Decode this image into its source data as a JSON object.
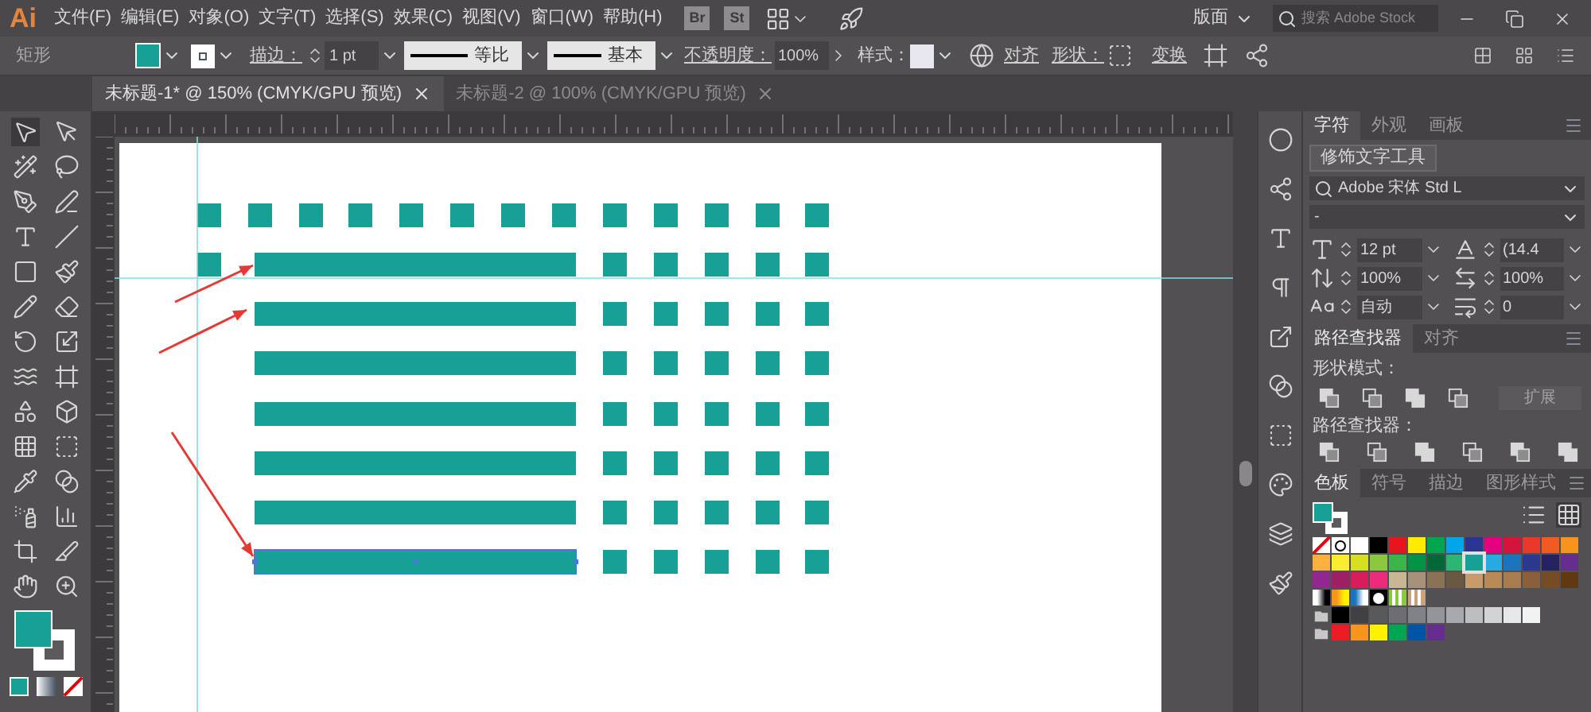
{
  "app": {
    "logo": "Ai",
    "menu": [
      "文件(F)",
      "编辑(E)",
      "对象(O)",
      "文字(T)",
      "选择(S)",
      "效果(C)",
      "视图(V)",
      "窗口(W)",
      "帮助(H)"
    ],
    "bridge": "Br",
    "stock": "St",
    "workspace": "版面",
    "search_placeholder": "搜索 Adobe Stock"
  },
  "fill": {
    "color": "#16a096"
  },
  "control_bar": {
    "object_type": "矩形",
    "stroke_label": "描边：",
    "stroke_weight": "1 pt",
    "profile_1": "等比",
    "profile_2": "基本",
    "opacity_label": "不透明度：",
    "opacity": "100%",
    "style_label": "样式：",
    "align": "对齐",
    "shape_label": "形状：",
    "transform": "变换"
  },
  "tabs": [
    {
      "label": "未标题-1* @ 150% (CMYK/GPU 预览)",
      "selected": true
    },
    {
      "label": "未标题-2 @ 100% (CMYK/GPU 预览)",
      "selected": false
    }
  ],
  "character_panel": {
    "tabs": [
      {
        "label": "字符",
        "selected": true
      },
      {
        "label": "外观",
        "selected": false
      },
      {
        "label": "画板",
        "selected": false
      }
    ],
    "touch_type_button": "修饰文字工具",
    "font": "Adobe 宋体 Std L",
    "style": "-",
    "fields": [
      {
        "kind": "size",
        "value": "12 pt"
      },
      {
        "kind": "leading",
        "value": "(14.4 "
      },
      {
        "kind": "vscale",
        "value": "100%"
      },
      {
        "kind": "hscale",
        "value": "100%"
      },
      {
        "kind": "kerning",
        "value": "自动"
      },
      {
        "kind": "tracking",
        "value": "0"
      }
    ]
  },
  "pathfinder_panel": {
    "tabs": [
      {
        "label": "路径查找器",
        "selected": true
      },
      {
        "label": "对齐",
        "selected": false
      }
    ],
    "shape_modes_label": "形状模式：",
    "expand_button": {
      "label": "扩展",
      "disabled": true
    },
    "pathfinders_label": "路径查找器："
  },
  "swatches_panel": {
    "tabs": [
      {
        "label": "色板",
        "selected": true
      },
      {
        "label": "符号",
        "selected": false
      },
      {
        "label": "描边",
        "selected": false
      },
      {
        "label": "图形样式",
        "selected": false
      }
    ],
    "rows": [
      [
        {
          "kind": "none",
          "selected": false
        },
        {
          "kind": "registration",
          "selected": false
        },
        {
          "kind": "solid",
          "color": "#ffffff",
          "selected": false
        },
        {
          "kind": "solid",
          "color": "#000000",
          "selected": false
        },
        {
          "kind": "solid",
          "color": "#e6151e",
          "selected": false
        },
        {
          "kind": "solid",
          "color": "#ffec00",
          "selected": false
        },
        {
          "kind": "solid",
          "color": "#00a550",
          "selected": false
        },
        {
          "kind": "solid",
          "color": "#00a6e8",
          "selected": false
        },
        {
          "kind": "solid",
          "color": "#2b3490",
          "selected": false
        },
        {
          "kind": "solid",
          "color": "#e5007f",
          "selected": false
        },
        {
          "kind": "solid",
          "color": "#d4143a",
          "selected": false
        },
        {
          "kind": "solid",
          "color": "#e8392b",
          "selected": false
        },
        {
          "kind": "solid",
          "color": "#f15a22",
          "selected": false
        },
        {
          "kind": "solid",
          "color": "#f7941d",
          "selected": false
        }
      ],
      [
        {
          "kind": "solid",
          "color": "#fbb040",
          "selected": false
        },
        {
          "kind": "solid",
          "color": "#f9ed32",
          "selected": false
        },
        {
          "kind": "solid",
          "color": "#d7df23",
          "selected": false
        },
        {
          "kind": "solid",
          "color": "#8dc63f",
          "selected": false
        },
        {
          "kind": "solid",
          "color": "#39b54a",
          "selected": false
        },
        {
          "kind": "solid",
          "color": "#009444",
          "selected": false
        },
        {
          "kind": "solid",
          "color": "#006838",
          "selected": false
        },
        {
          "kind": "solid",
          "color": "#2bb673",
          "selected": false
        },
        {
          "kind": "solid",
          "color": "#16a096",
          "selected": true
        },
        {
          "kind": "solid",
          "color": "#27aae1",
          "selected": false
        },
        {
          "kind": "solid",
          "color": "#1c75bc",
          "selected": false
        },
        {
          "kind": "solid",
          "color": "#2b388f",
          "selected": false
        },
        {
          "kind": "solid",
          "color": "#262262",
          "selected": false
        },
        {
          "kind": "solid",
          "color": "#662d91",
          "selected": false
        }
      ],
      [
        {
          "kind": "solid",
          "color": "#92278f",
          "selected": false
        },
        {
          "kind": "solid",
          "color": "#9e1f63",
          "selected": false
        },
        {
          "kind": "solid",
          "color": "#da1c5c",
          "selected": false
        },
        {
          "kind": "solid",
          "color": "#ee2a7b",
          "selected": false
        },
        {
          "kind": "solid",
          "color": "#c8b695",
          "selected": false
        },
        {
          "kind": "solid",
          "color": "#a6927a",
          "selected": false
        },
        {
          "kind": "solid",
          "color": "#8a7257",
          "selected": false
        },
        {
          "kind": "solid",
          "color": "#6b5843",
          "selected": false
        },
        {
          "kind": "solid",
          "color": "#c69c6d",
          "selected": false
        },
        {
          "kind": "solid",
          "color": "#b88a55",
          "selected": false
        },
        {
          "kind": "solid",
          "color": "#a97c50",
          "selected": false
        },
        {
          "kind": "solid",
          "color": "#8b5e3c",
          "selected": false
        },
        {
          "kind": "solid",
          "color": "#754c24",
          "selected": false
        },
        {
          "kind": "solid",
          "color": "#603913",
          "selected": false
        }
      ],
      [
        {
          "kind": "gradient",
          "stops": [
            {
              "color": "#ffffff"
            },
            {
              "color": "#000000"
            }
          ],
          "selected": false
        },
        {
          "kind": "gradient",
          "stops": [
            {
              "color": "#f7941d"
            },
            {
              "color": "#fff200"
            }
          ],
          "selected": false
        },
        {
          "kind": "gradient",
          "stops": [
            {
              "color": "#1c75bc"
            },
            {
              "color": "#ffffff"
            }
          ],
          "selected": false
        },
        {
          "kind": "radial",
          "stops": [
            {
              "color": "#ffffff"
            },
            {
              "color": "#000000"
            }
          ],
          "selected": false
        },
        {
          "kind": "pattern",
          "color": "#8dc63f",
          "selected": false
        },
        {
          "kind": "pattern",
          "color": "#c8a27a",
          "selected": false
        }
      ],
      [
        {
          "kind": "folder",
          "selected": false
        },
        {
          "kind": "solid",
          "color": "#000000",
          "selected": false
        },
        {
          "kind": "solid",
          "color": "#414042",
          "selected": false
        },
        {
          "kind": "solid",
          "color": "#58595b",
          "selected": false
        },
        {
          "kind": "solid",
          "color": "#6d6e71",
          "selected": false
        },
        {
          "kind": "solid",
          "color": "#808285",
          "selected": false
        },
        {
          "kind": "solid",
          "color": "#939598",
          "selected": false
        },
        {
          "kind": "solid",
          "color": "#a7a9ac",
          "selected": false
        },
        {
          "kind": "solid",
          "color": "#bcbec0",
          "selected": false
        },
        {
          "kind": "solid",
          "color": "#d1d3d4",
          "selected": false
        },
        {
          "kind": "solid",
          "color": "#e6e7e8",
          "selected": false
        },
        {
          "kind": "solid",
          "color": "#f1f2f2",
          "selected": false
        }
      ],
      [
        {
          "kind": "folder",
          "selected": false
        },
        {
          "kind": "solid",
          "color": "#ed1c24",
          "selected": false
        },
        {
          "kind": "solid",
          "color": "#f7941d",
          "selected": false
        },
        {
          "kind": "solid",
          "color": "#fff200",
          "selected": false
        },
        {
          "kind": "solid",
          "color": "#00a651",
          "selected": false
        },
        {
          "kind": "solid",
          "color": "#0054a6",
          "selected": false
        },
        {
          "kind": "solid",
          "color": "#662d91",
          "selected": false
        }
      ]
    ]
  }
}
